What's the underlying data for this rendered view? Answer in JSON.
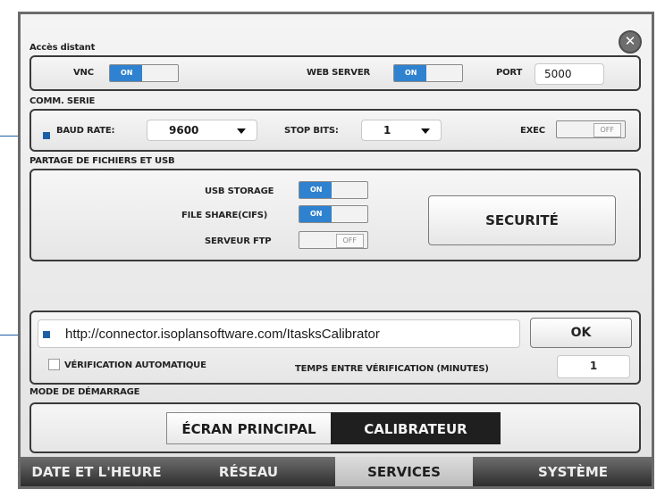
{
  "close_icon": "x-circle-icon",
  "sections": {
    "remote": "Accès distant",
    "serial": "COMM. SERIE",
    "sharing": "PARTAGE DE FICHIERS ET USB",
    "startup": "MODE DE DÉMARRAGE"
  },
  "remote": {
    "vnc_label": "VNC",
    "vnc_state": "ON",
    "webserver_label": "WEB SERVER",
    "webserver_state": "ON",
    "port_label": "PORT",
    "port_value": "5000"
  },
  "serial": {
    "baud_label": "BAUD RATE:",
    "baud_value": "9600",
    "stopbits_label": "STOP BITS:",
    "stopbits_value": "1",
    "exec_label": "EXEC",
    "exec_state": "OFF"
  },
  "sharing": {
    "usb_label": "USB STORAGE",
    "usb_state": "ON",
    "cifs_label": "FILE SHARE(CIFS)",
    "cifs_state": "ON",
    "ftp_label": "SERVEUR FTP",
    "ftp_state": "OFF",
    "security_button": "SECURITÉ"
  },
  "update": {
    "url": "http://connector.isoplansoftware.com/ItasksCalibrator",
    "ok_button": "OK",
    "auto_check_label": "VÉRIFICATION AUTOMATIQUE",
    "auto_check_checked": false,
    "interval_label": "TEMPS ENTRE VÉRIFICATION (MINUTES)",
    "interval_value": "1"
  },
  "startup": {
    "options": [
      "ÉCRAN PRINCIPAL",
      "CALIBRATEUR"
    ],
    "selected": "CALIBRATEUR"
  },
  "tabs": [
    "DATE ET L'HEURE",
    "RÉSEAU",
    "SERVICES",
    "SYSTÈME"
  ],
  "active_tab": "SERVICES",
  "colors": {
    "toggle_on": "#2f82cf",
    "callout": "#1d5fa6",
    "selected_segment": "#1f1f1f",
    "tab_bar": "#3a3a3a"
  }
}
